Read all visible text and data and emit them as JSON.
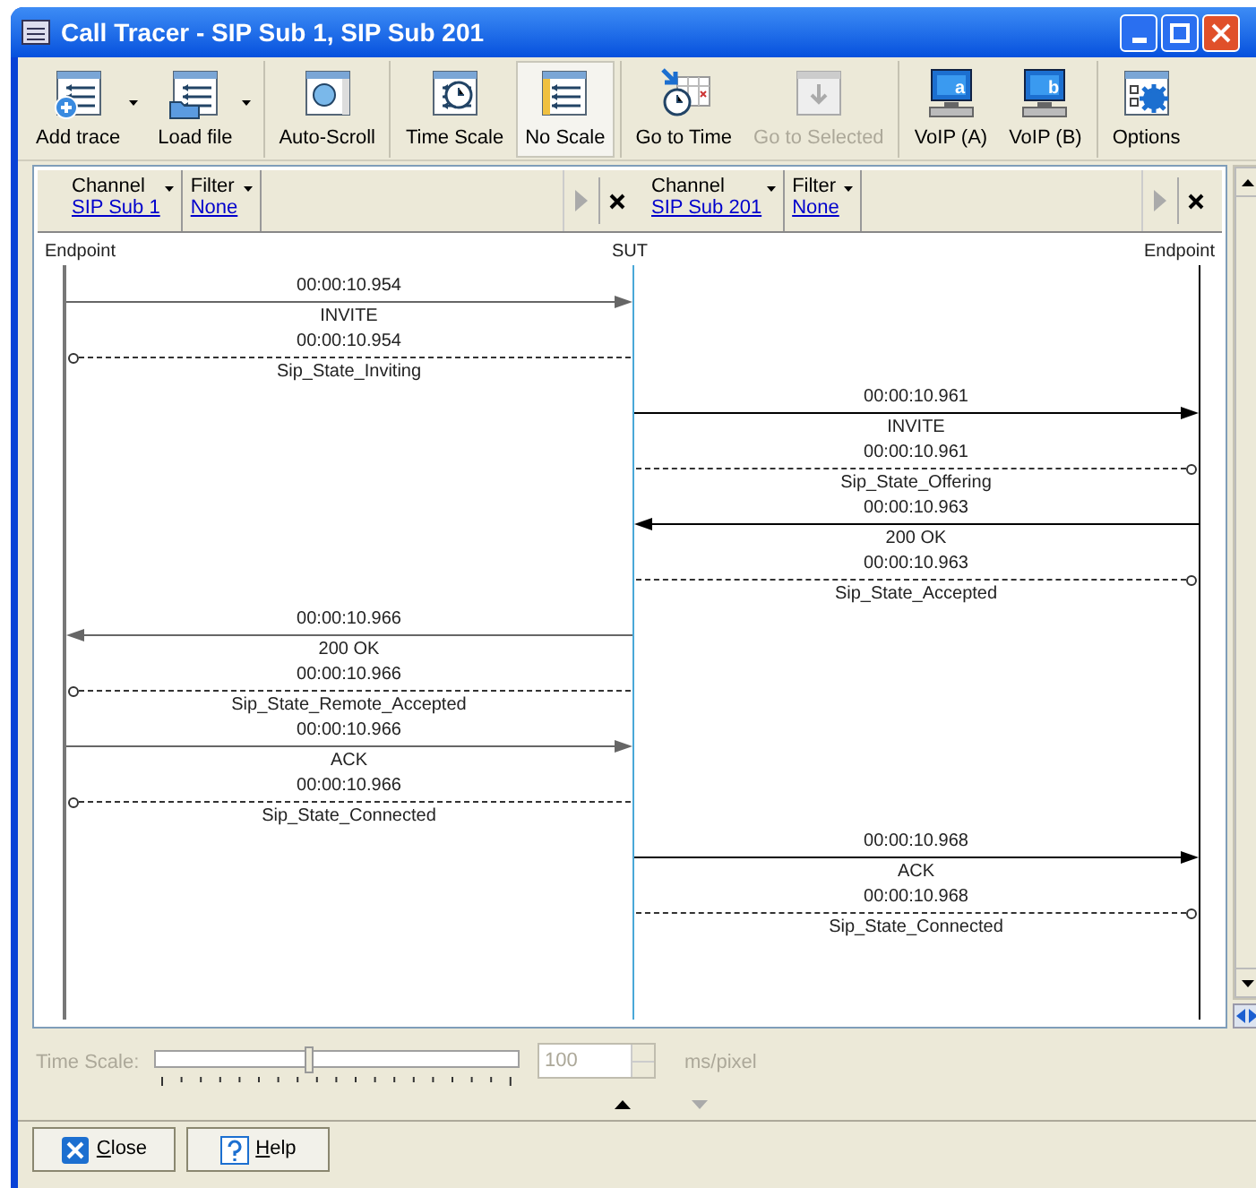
{
  "window": {
    "title": "Call Tracer - SIP Sub 1, SIP Sub 201"
  },
  "toolbar_groups": [
    [
      {
        "label": "Add trace",
        "menu": true,
        "selected": false,
        "disabled": false
      },
      {
        "label": "Load file",
        "menu": true,
        "selected": false,
        "disabled": false
      }
    ],
    [
      {
        "label": "Auto-Scroll",
        "menu": false,
        "selected": false,
        "disabled": false
      }
    ],
    [
      {
        "label": "Time Scale",
        "menu": false,
        "selected": false,
        "disabled": false
      },
      {
        "label": "No Scale",
        "menu": false,
        "selected": true,
        "disabled": false
      }
    ],
    [
      {
        "label": "Go to Time",
        "menu": false,
        "selected": false,
        "disabled": false
      },
      {
        "label": "Go to Selected",
        "menu": false,
        "selected": false,
        "disabled": true
      }
    ],
    [
      {
        "label": "VoIP (A)",
        "icon_letter": "a",
        "menu": false,
        "selected": false,
        "disabled": false
      },
      {
        "label": "VoIP (B)",
        "icon_letter": "b",
        "menu": false,
        "selected": false,
        "disabled": false
      }
    ],
    [
      {
        "label": "Options",
        "menu": false,
        "selected": false,
        "disabled": false
      }
    ]
  ],
  "panes": [
    {
      "channel_label": "Channel",
      "channel": "SIP Sub 1",
      "filter_label": "Filter",
      "filter": "None"
    },
    {
      "channel_label": "Channel",
      "channel": "SIP Sub 201",
      "filter_label": "Filter",
      "filter": "None"
    }
  ],
  "lifelines": [
    "Endpoint",
    "SUT",
    "Endpoint"
  ],
  "events": [
    {
      "on_right": false,
      "kind": "message",
      "points_right": true,
      "time": "00:00:10.954",
      "label": "INVITE"
    },
    {
      "on_right": false,
      "kind": "state",
      "time": "00:00:10.954",
      "label": "Sip_State_Inviting"
    },
    {
      "on_right": true,
      "kind": "message",
      "points_right": true,
      "time": "00:00:10.961",
      "label": "INVITE"
    },
    {
      "on_right": true,
      "kind": "state",
      "time": "00:00:10.961",
      "label": "Sip_State_Offering"
    },
    {
      "on_right": true,
      "kind": "message",
      "points_right": false,
      "time": "00:00:10.963",
      "label": "200 OK"
    },
    {
      "on_right": true,
      "kind": "state",
      "time": "00:00:10.963",
      "label": "Sip_State_Accepted"
    },
    {
      "on_right": false,
      "kind": "message",
      "points_right": false,
      "time": "00:00:10.966",
      "label": "200 OK"
    },
    {
      "on_right": false,
      "kind": "state",
      "time": "00:00:10.966",
      "label": "Sip_State_Remote_Accepted"
    },
    {
      "on_right": false,
      "kind": "message",
      "points_right": true,
      "time": "00:00:10.966",
      "label": "ACK"
    },
    {
      "on_right": false,
      "kind": "state",
      "time": "00:00:10.966",
      "label": "Sip_State_Connected"
    },
    {
      "on_right": true,
      "kind": "message",
      "points_right": true,
      "time": "00:00:10.968",
      "label": "ACK"
    },
    {
      "on_right": true,
      "kind": "state",
      "time": "00:00:10.968",
      "label": "Sip_State_Connected"
    }
  ],
  "time_scale": {
    "label": "Time Scale:",
    "disabled": true,
    "level": 0.42,
    "value": "100",
    "unit": "ms/pixel"
  },
  "buttons": [
    "Close",
    "Help"
  ]
}
